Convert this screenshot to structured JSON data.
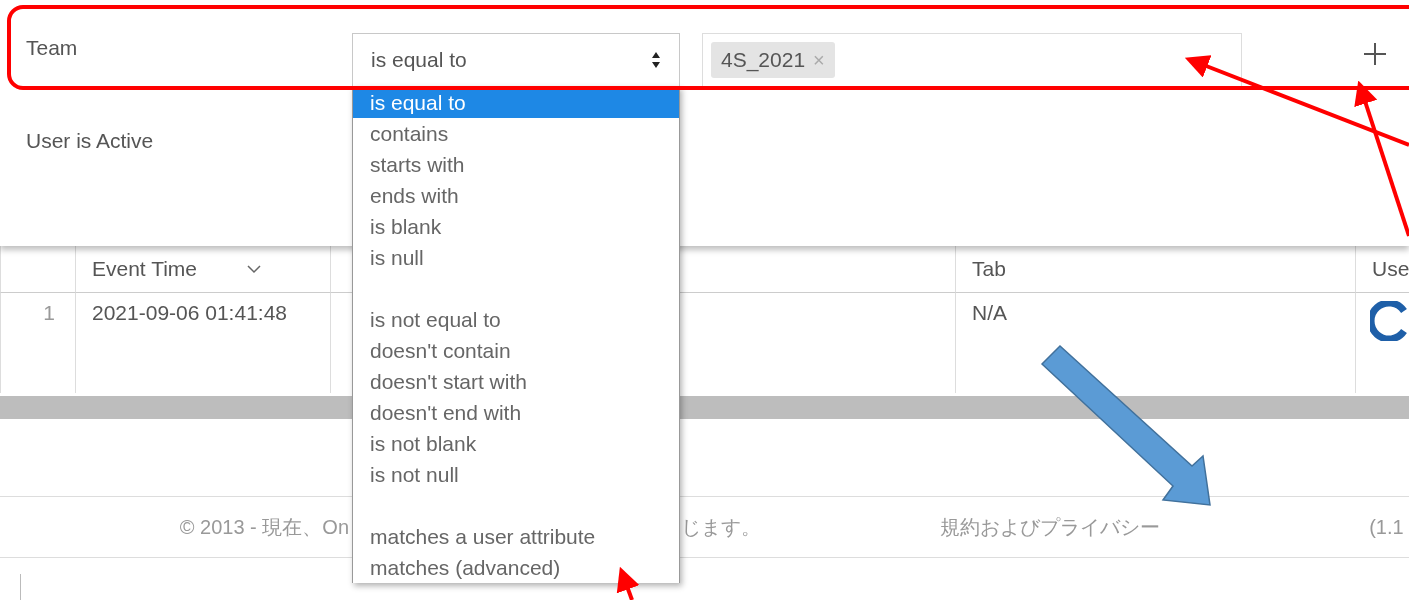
{
  "filters": [
    {
      "label": "Team",
      "operator": "is equal to",
      "values": [
        {
          "text": "4S_2021",
          "remove": "×"
        }
      ]
    },
    {
      "label": "User is Active"
    }
  ],
  "operator_menu": {
    "groups": [
      {
        "options": [
          {
            "label": "is equal to",
            "selected": true
          },
          {
            "label": "contains",
            "selected": false
          },
          {
            "label": "starts with",
            "selected": false
          },
          {
            "label": "ends with",
            "selected": false
          },
          {
            "label": "is blank",
            "selected": false
          },
          {
            "label": "is null",
            "selected": false
          }
        ]
      },
      {
        "options": [
          {
            "label": "is not equal to",
            "selected": false
          },
          {
            "label": "doesn't contain",
            "selected": false
          },
          {
            "label": "doesn't start with",
            "selected": false
          },
          {
            "label": "doesn't end with",
            "selected": false
          },
          {
            "label": "is not blank",
            "selected": false
          },
          {
            "label": "is not null",
            "selected": false
          }
        ]
      },
      {
        "options": [
          {
            "label": "matches a user attribute",
            "selected": false
          },
          {
            "label": "matches (advanced)",
            "selected": false
          }
        ]
      }
    ]
  },
  "table": {
    "columns": [
      "",
      "Event Time",
      "",
      "Tab",
      "Use"
    ],
    "rows": [
      {
        "number": "1",
        "event_time": "2021-09-06 01:41:48",
        "column_3": "",
        "tab": "N/A"
      }
    ]
  },
  "footer": {
    "copyright_start": "© 2013 - 現在、On",
    "copyright_end": "じます。",
    "terms_link": "規約およびプライバシー",
    "version": "(1.1"
  }
}
